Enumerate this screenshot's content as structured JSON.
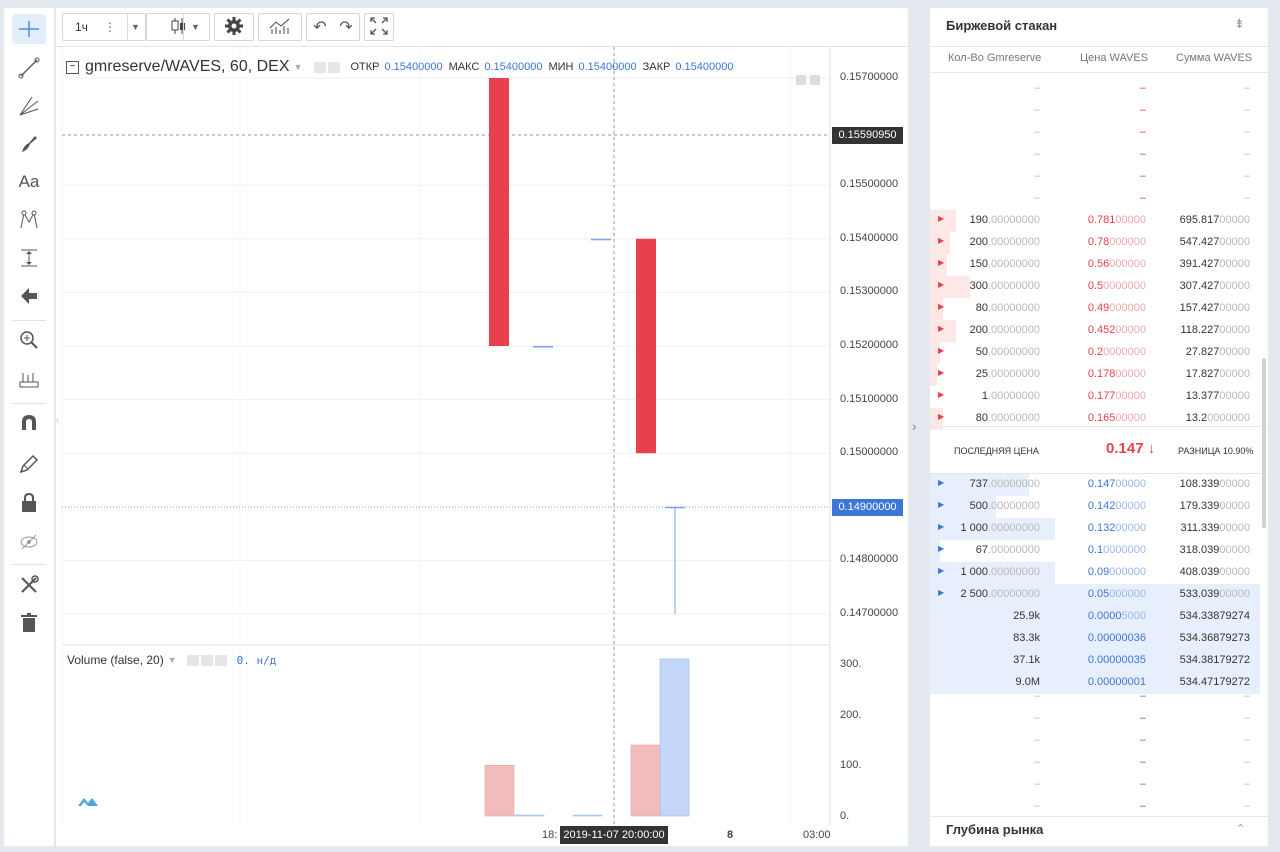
{
  "top_toolbar": {
    "interval": "1ч",
    "settings_icon": "gear-icon",
    "indicators_icon": "indicators-icon",
    "undo_icon": "undo-icon",
    "redo_icon": "redo-icon",
    "fullscreen_icon": "fullscreen-icon"
  },
  "left_tools": [
    "crosshair-icon",
    "trend-line-icon",
    "fib-icon",
    "brush-icon",
    "text-icon",
    "pattern-icon",
    "measure-icon",
    "arrow-icon",
    "zoom-icon",
    "ruler-icon",
    "magnet-icon",
    "pencil-lock-icon",
    "lock-icon",
    "hide-icon",
    "tools-icon",
    "trash-icon"
  ],
  "chart": {
    "symbol": "gmreserve/WAVES, 60, DEX",
    "ohlc": {
      "open_label": "ОТКР",
      "open": "0.15400000",
      "high_label": "МАКС",
      "high": "0.15400000",
      "low_label": "МИН",
      "low": "0.15400000",
      "close_label": "ЗАКР",
      "close": "0.15400000"
    },
    "price_ticks": [
      "0.15700000",
      "0.15500000",
      "0.15400000",
      "0.15300000",
      "0.15200000",
      "0.15100000",
      "0.15000000",
      "0.14800000",
      "0.14700000"
    ],
    "crosshair_price": "0.15590950",
    "current_price": "0.14900000",
    "volume_title": "Volume (false, 20)",
    "volume_value": "0. н/д",
    "volume_ticks": [
      "300.",
      "200.",
      "100.",
      "0."
    ],
    "time_ticks": [
      "18:",
      "8",
      "03:00"
    ],
    "crosshair_time": "2019-11-07 20:00:00",
    "colors": {
      "down": "#e8414d",
      "up": "#7aa6e8",
      "down_volume": "#f2bcbc",
      "up_volume": "#c4d6f7"
    },
    "candles": [
      {
        "open": 0.157,
        "close": 0.152,
        "high": 0.157,
        "low": 0.152,
        "dir": "down"
      },
      {
        "open": 0.152,
        "close": 0.152,
        "high": 0.152,
        "low": 0.152,
        "dir": "flat"
      },
      {
        "open": 0.154,
        "close": 0.154,
        "high": 0.154,
        "low": 0.154,
        "dir": "flat"
      },
      {
        "open": 0.154,
        "close": 0.15,
        "high": 0.154,
        "low": 0.15,
        "dir": "down"
      },
      {
        "open": 0.149,
        "close": 0.149,
        "high": 0.149,
        "low": 0.147,
        "dir": "flat"
      }
    ],
    "volumes": [
      100,
      0,
      0,
      140,
      310
    ]
  },
  "order_book": {
    "title": "Биржевой стакан",
    "headers": [
      "Кол-Во Gmreserve",
      "Цена WAVES",
      "Сумма WAVES"
    ],
    "asks": [
      {
        "amount": "190",
        "amount_dim": ".00000000",
        "price": "0.781",
        "price_dim": "00000",
        "total": "695.817",
        "total_dim": "00000",
        "depth": 0.08
      },
      {
        "amount": "200",
        "amount_dim": ".00000000",
        "price": "0.78",
        "price_dim": "000000",
        "total": "547.427",
        "total_dim": "00000",
        "depth": 0.06
      },
      {
        "amount": "150",
        "amount_dim": ".00000000",
        "price": "0.56",
        "price_dim": "000000",
        "total": "391.427",
        "total_dim": "00000",
        "depth": 0.05
      },
      {
        "amount": "300",
        "amount_dim": ".00000000",
        "price": "0.5",
        "price_dim": "0000000",
        "total": "307.427",
        "total_dim": "00000",
        "depth": 0.12
      },
      {
        "amount": "80",
        "amount_dim": ".00000000",
        "price": "0.49",
        "price_dim": "000000",
        "total": "157.427",
        "total_dim": "00000",
        "depth": 0.04
      },
      {
        "amount": "200",
        "amount_dim": ".00000000",
        "price": "0.452",
        "price_dim": "00000",
        "total": "118.227",
        "total_dim": "00000",
        "depth": 0.08
      },
      {
        "amount": "50",
        "amount_dim": ".00000000",
        "price": "0.2",
        "price_dim": "0000000",
        "total": "27.827",
        "total_dim": "00000",
        "depth": 0.03
      },
      {
        "amount": "25",
        "amount_dim": ".00000000",
        "price": "0.178",
        "price_dim": "00000",
        "total": "17.827",
        "total_dim": "00000",
        "depth": 0.02
      },
      {
        "amount": "1",
        "amount_dim": ".00000000",
        "price": "0.177",
        "price_dim": "00000",
        "total": "13.377",
        "total_dim": "00000",
        "depth": 0.0
      },
      {
        "amount": "80",
        "amount_dim": ".00000000",
        "price": "0.165",
        "price_dim": "00000",
        "total": "13.2",
        "total_dim": "0000000",
        "depth": 0.04
      }
    ],
    "last_price_label": "ПОСЛЕДНЯЯ ЦЕНА",
    "last_price": "0.147 ↓",
    "spread_label": "РАЗНИЦА 10.90%",
    "bids": [
      {
        "amount": "737",
        "amount_dim": ".00000000",
        "price": "0.147",
        "price_dim": "00000",
        "total": "108.339",
        "total_dim": "00000",
        "depth": 0.3,
        "marker": true
      },
      {
        "amount": "500",
        "amount_dim": ".00000000",
        "price": "0.142",
        "price_dim": "00000",
        "total": "179.339",
        "total_dim": "00000",
        "depth": 0.2,
        "marker": true
      },
      {
        "amount": "1 000",
        "amount_dim": ".00000000",
        "price": "0.132",
        "price_dim": "00000",
        "total": "311.339",
        "total_dim": "00000",
        "depth": 0.38,
        "marker": true
      },
      {
        "amount": "67",
        "amount_dim": ".00000000",
        "price": "0.1",
        "price_dim": "0000000",
        "total": "318.039",
        "total_dim": "00000",
        "depth": 0.03,
        "marker": true
      },
      {
        "amount": "1 000",
        "amount_dim": ".00000000",
        "price": "0.09",
        "price_dim": "000000",
        "total": "408.039",
        "total_dim": "00000",
        "depth": 0.38,
        "marker": true
      },
      {
        "amount": "2 500",
        "amount_dim": ".00000000",
        "price": "0.05",
        "price_dim": "000000",
        "total": "533.039",
        "total_dim": "00000",
        "depth": 1.0,
        "marker": true
      },
      {
        "amount": "25.9k",
        "amount_dim": "",
        "price": "0.0000",
        "price_dim": "5000",
        "total": "534.33879274",
        "total_dim": "",
        "depth": 1.0,
        "marker": false
      },
      {
        "amount": "83.3k",
        "amount_dim": "",
        "price": "0.00000036",
        "price_dim": "",
        "total": "534.36879273",
        "total_dim": "",
        "depth": 1.0,
        "marker": false
      },
      {
        "amount": "37.1k",
        "amount_dim": "",
        "price": "0.00000035",
        "price_dim": "",
        "total": "534.38179272",
        "total_dim": "",
        "depth": 1.0,
        "marker": false
      },
      {
        "amount": "9.0M",
        "amount_dim": "",
        "price": "0.00000001",
        "price_dim": "",
        "total": "534.47179272",
        "total_dim": "",
        "depth": 1.0,
        "marker": false
      }
    ],
    "empty_symbol": "–",
    "depth_title": "Глубина рынка"
  }
}
